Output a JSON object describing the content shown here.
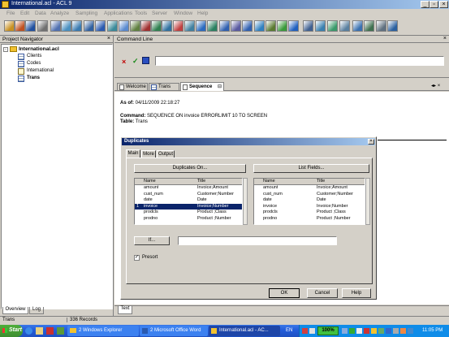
{
  "window": {
    "title": "International.acl - ACL 9"
  },
  "menu": [
    "File",
    "Edit",
    "Data",
    "Analyze",
    "Sampling",
    "Applications",
    "Tools",
    "Server",
    "Window",
    "Help"
  ],
  "navigator": {
    "title": "Project Navigator",
    "root": "International.acl",
    "items": [
      "Clients",
      "Codes",
      "International",
      "Trans"
    ],
    "tabs": [
      "Overview",
      "Log"
    ]
  },
  "command_line": {
    "title": "Command Line",
    "value": ""
  },
  "tabs": [
    "Welcome",
    "Trans",
    "Sequence"
  ],
  "results": {
    "as_of_label": "As of:",
    "as_of_value": "04/11/2009 22:18:27",
    "command_label": "Command:",
    "command_value": "SEQUENCE ON invoice ERRORLIMIT 10 TO SCREEN",
    "table_label": "Table:",
    "table_value": "Trans"
  },
  "dialog": {
    "title": "Duplicates",
    "tabs": [
      "Main",
      "More",
      "Output"
    ],
    "left_button": "Duplicates On...",
    "right_button": "List Fields...",
    "col_name": "Name",
    "col_title": "Title",
    "left_rows": [
      {
        "num": "",
        "name": "amount",
        "title": "Invoice;Amount"
      },
      {
        "num": "",
        "name": "cust_num",
        "title": "Customer;Number"
      },
      {
        "num": "",
        "name": "date",
        "title": "Date"
      },
      {
        "num": "1",
        "name": "invoice",
        "title": "Invoice;Number"
      },
      {
        "num": "",
        "name": "prodcls",
        "title": "Product ;Class"
      },
      {
        "num": "",
        "name": "prodno",
        "title": "Product ;Number"
      }
    ],
    "right_rows": [
      {
        "name": "amount",
        "title": "Invoice;Amount"
      },
      {
        "name": "cust_num",
        "title": "Customer;Number"
      },
      {
        "name": "date",
        "title": "Date"
      },
      {
        "name": "invoice",
        "title": "Invoice;Number"
      },
      {
        "name": "prodcls",
        "title": "Product ;Class"
      },
      {
        "name": "prodno",
        "title": "Product ;Number"
      }
    ],
    "if_button": "If...",
    "if_value": "",
    "presort_label": "Presort",
    "ok": "OK",
    "cancel": "Cancel",
    "help": "Help"
  },
  "bottom_tab": "Text",
  "status": {
    "table": "Trans",
    "records": "336 Records"
  },
  "taskbar": {
    "start": "Start",
    "items": [
      "2 Windows Explorer",
      "2 Microsoft Office Word",
      "International.acl - AC..."
    ],
    "lang": "EN",
    "zoom": "100%",
    "time": "11:05 PM"
  },
  "colors": {
    "title_start": "#0a246a",
    "title_end": "#a6caf0",
    "selection": "#0a246a",
    "taskbar": "#245edb",
    "start": "#3c8d2f"
  }
}
